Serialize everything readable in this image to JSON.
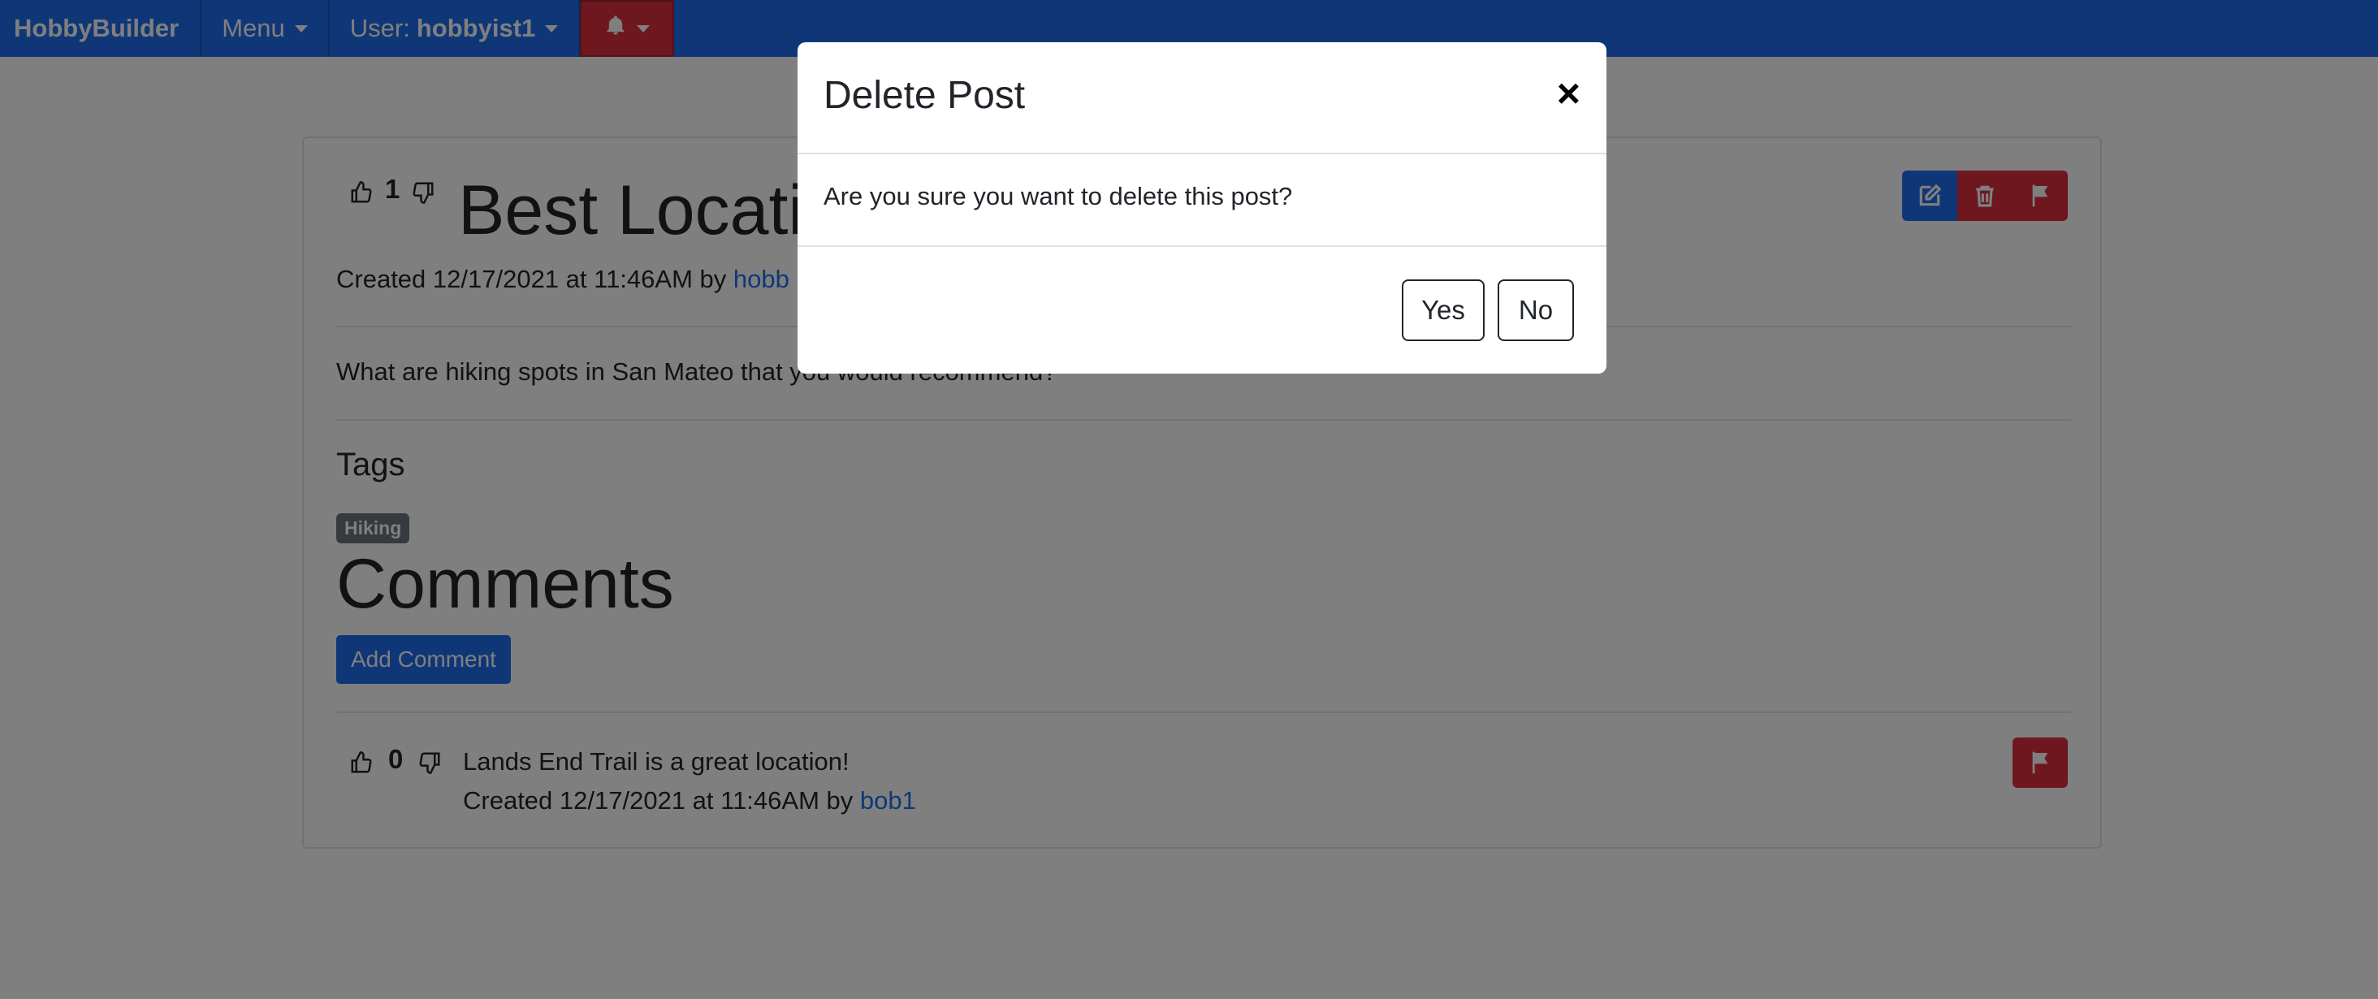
{
  "navbar": {
    "brand": "HobbyBuilder",
    "menu_label": "Menu",
    "user_prefix": "User:",
    "username": "hobbyist1",
    "bell_color": "#dc2f3f"
  },
  "post": {
    "votes": "1",
    "title": "Best Locatio",
    "created_text": "Created 12/17/2021 at 11:46AM by",
    "author_visible": "hobb",
    "body": "What are hiking spots in San Mateo that you would recommend?",
    "tags_heading": "Tags",
    "tags": [
      "Hiking"
    ],
    "comments_heading": "Comments",
    "add_comment_label": "Add Comment"
  },
  "comment": {
    "votes": "0",
    "text": "Lands End Trail is a great location!",
    "created_text": "Created 12/17/2021 at 11:46AM by",
    "author": "bob1"
  },
  "modal": {
    "title": "Delete Post",
    "close_glyph": "×",
    "body": "Are you sure you want to delete this post?",
    "yes_label": "Yes",
    "no_label": "No"
  },
  "colors": {
    "primary": "#1f6ff0",
    "danger": "#dc2f3f",
    "secondary": "#6c757d"
  }
}
